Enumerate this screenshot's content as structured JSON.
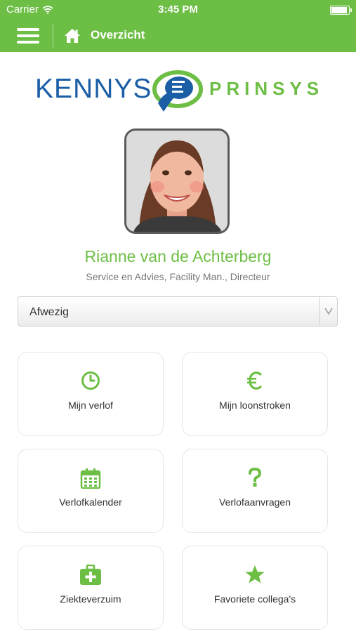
{
  "status_bar": {
    "carrier": "Carrier",
    "time": "3:45 PM"
  },
  "nav": {
    "title": "Overzicht",
    "menu_icon": "hamburger-menu-icon",
    "home_icon": "home-icon"
  },
  "logo": {
    "left_text": "KENNYS",
    "right_text": "PRINSYS"
  },
  "profile": {
    "name": "Rianne van de Achterberg",
    "role": "Service en Advies, Facility Man., Directeur"
  },
  "status_select": {
    "value": "Afwezig"
  },
  "tiles": [
    {
      "label": "Mijn verlof",
      "icon": "clock-icon"
    },
    {
      "label": "Mijn loonstroken",
      "icon": "euro-icon"
    },
    {
      "label": "Verlofkalender",
      "icon": "calendar-icon"
    },
    {
      "label": "Verlofaanvragen",
      "icon": "question-icon"
    },
    {
      "label": "Ziekteverzuim",
      "icon": "first-aid-kit-icon"
    },
    {
      "label": "Favoriete collega's",
      "icon": "star-icon"
    }
  ],
  "colors": {
    "accent": "#6dbe45",
    "brand_blue": "#1b5ea6",
    "text": "#333333"
  }
}
